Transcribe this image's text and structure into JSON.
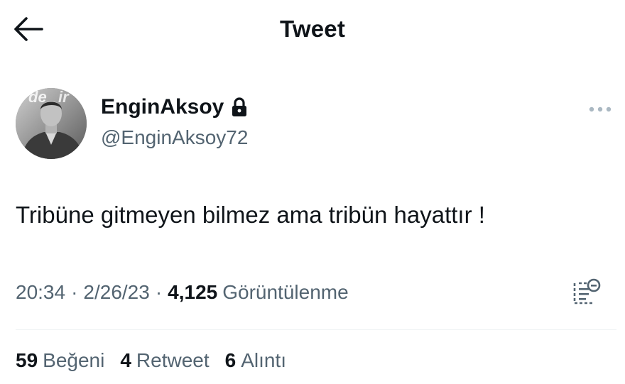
{
  "header": {
    "title": "Tweet",
    "back_icon": "arrow-left-icon"
  },
  "author": {
    "display_name": "EnginAksoy",
    "handle": "@EnginAksoy72",
    "protected_icon": "lock-icon",
    "avatar": "profile-photo",
    "more_icon": "more-horizontal-icon"
  },
  "tweet": {
    "text": "Tribüne gitmeyen bilmez ama tribün hayattır !"
  },
  "meta": {
    "time": "20:34",
    "separator": "·",
    "date": "2/26/23",
    "views_count": "4,125",
    "views_label": "Görüntülenme",
    "analytics_icon": "analytics-icon"
  },
  "stats": [
    {
      "count": "59",
      "label": "Beğeni"
    },
    {
      "count": "4",
      "label": "Retweet"
    },
    {
      "count": "6",
      "label": "Alıntı"
    }
  ],
  "colors": {
    "primary_text": "#0f1419",
    "secondary_text": "#536471",
    "divider": "#eff3f4",
    "background": "#ffffff"
  }
}
